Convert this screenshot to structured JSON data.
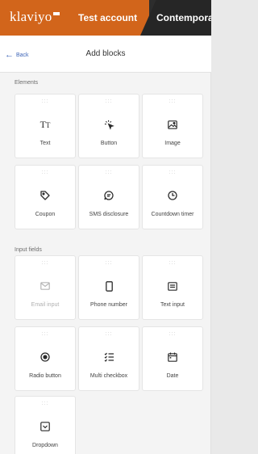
{
  "topbar": {
    "logo": "klaviyo",
    "account": "Test account",
    "workspace": "Contemporar"
  },
  "panel": {
    "back_label": "Back",
    "title": "Add blocks"
  },
  "sections": {
    "elements_label": "Elements",
    "input_fields_label": "Input fields"
  },
  "elements": [
    {
      "label": "Text",
      "icon": "text-icon"
    },
    {
      "label": "Button",
      "icon": "cursor-click-icon"
    },
    {
      "label": "Image",
      "icon": "image-icon"
    },
    {
      "label": "Coupon",
      "icon": "tag-icon"
    },
    {
      "label": "SMS disclosure",
      "icon": "message-icon"
    },
    {
      "label": "Countdown timer",
      "icon": "clock-icon"
    }
  ],
  "input_fields": [
    {
      "label": "Email input",
      "icon": "envelope-icon",
      "disabled": true
    },
    {
      "label": "Phone number",
      "icon": "phone-icon"
    },
    {
      "label": "Text input",
      "icon": "text-input-icon"
    },
    {
      "label": "Radio button",
      "icon": "radio-icon"
    },
    {
      "label": "Multi checkbox",
      "icon": "checklist-icon"
    },
    {
      "label": "Date",
      "icon": "calendar-icon"
    },
    {
      "label": "Dropdown",
      "icon": "dropdown-icon"
    }
  ],
  "colors": {
    "brand_orange": "#d2651b",
    "topbar_dark": "#2d2d2d",
    "back_link": "#3f66b8"
  }
}
